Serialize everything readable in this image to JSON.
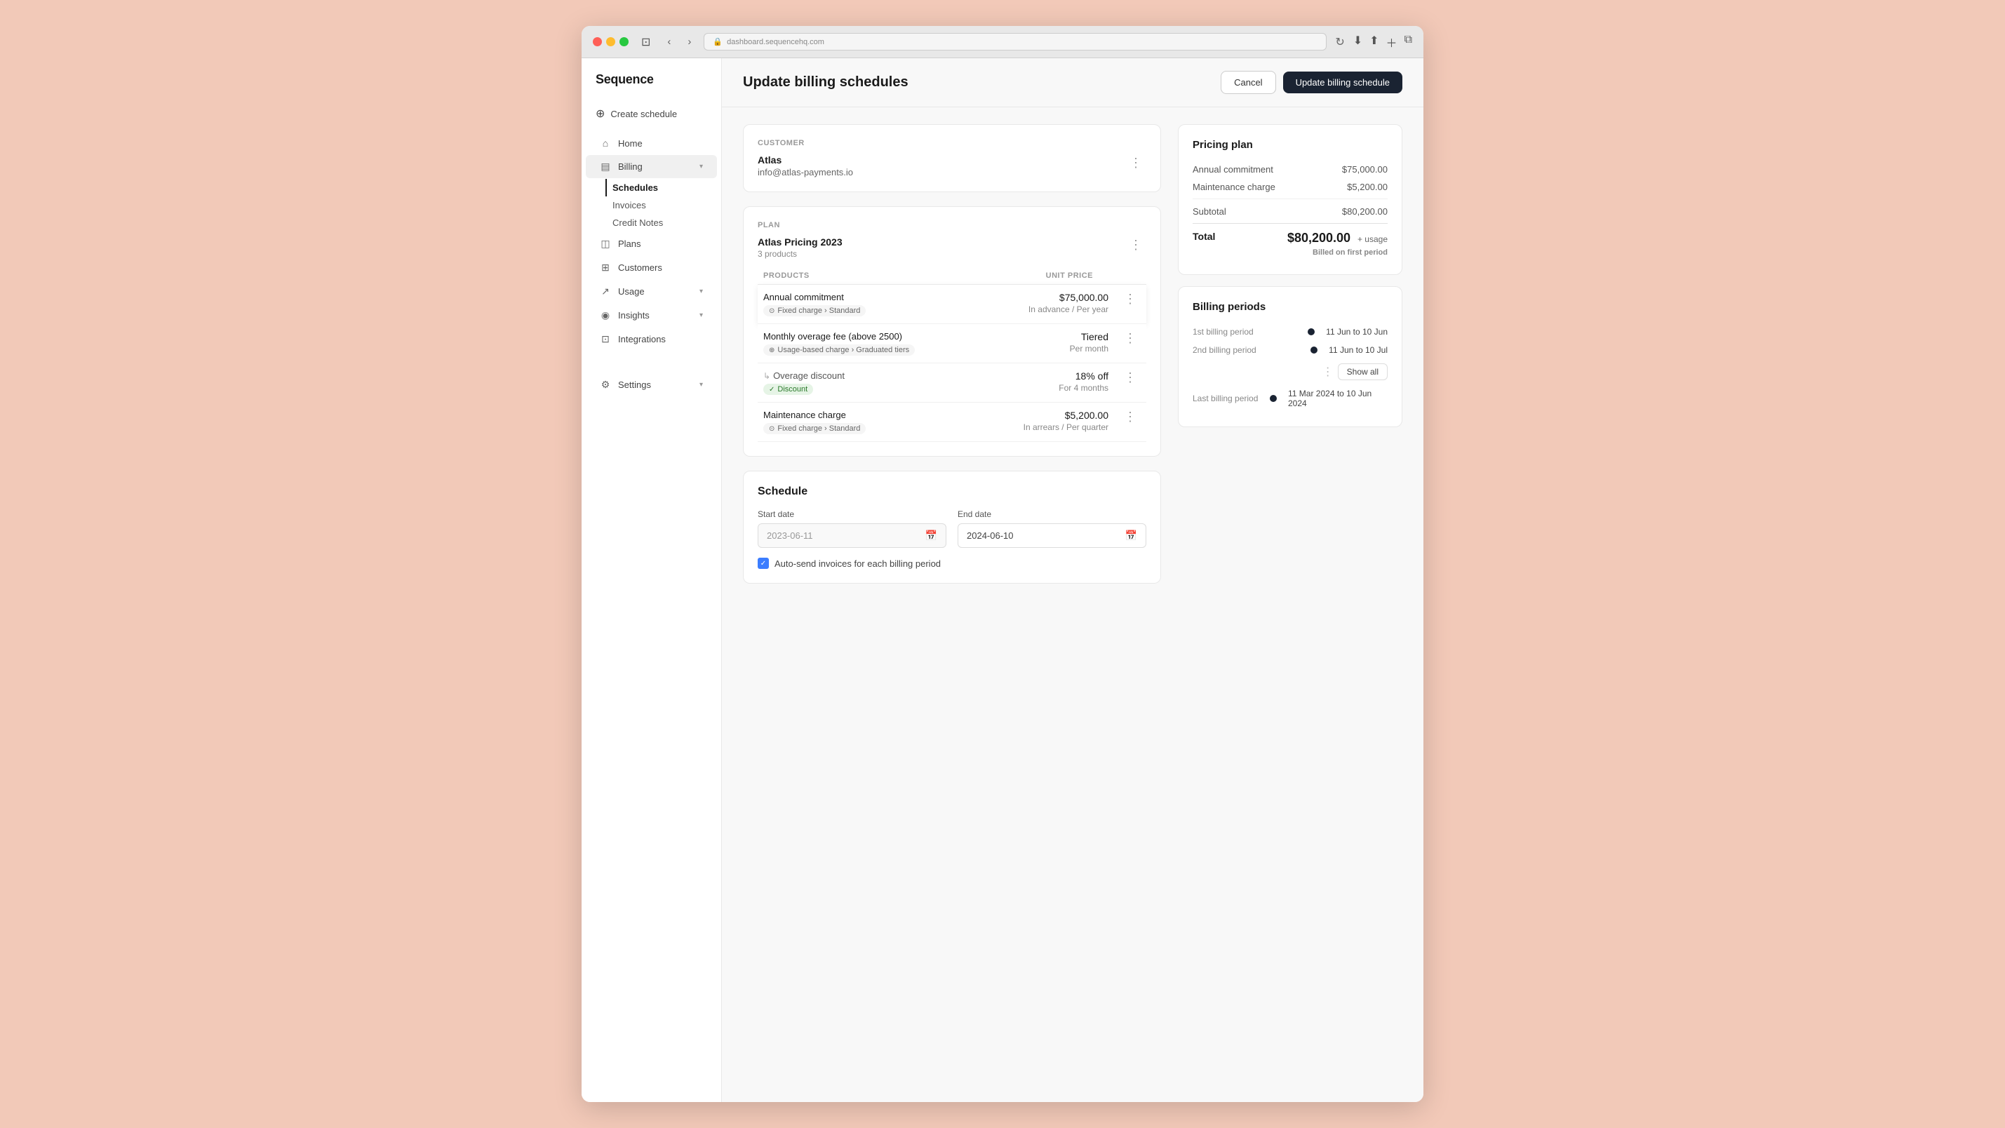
{
  "browser": {
    "url": "dashboard.sequencehq.com",
    "back": "‹",
    "forward": "›"
  },
  "sidebar": {
    "logo": "Sequence",
    "create_label": "Create schedule",
    "items": [
      {
        "id": "home",
        "label": "Home",
        "icon": "⌂"
      },
      {
        "id": "billing",
        "label": "Billing",
        "icon": "▤",
        "expanded": true,
        "children": [
          {
            "id": "schedules",
            "label": "Schedules",
            "active": true
          },
          {
            "id": "invoices",
            "label": "Invoices"
          },
          {
            "id": "credit-notes",
            "label": "Credit Notes"
          }
        ]
      },
      {
        "id": "plans",
        "label": "Plans",
        "icon": "◫"
      },
      {
        "id": "customers",
        "label": "Customers",
        "icon": "⊞"
      },
      {
        "id": "usage",
        "label": "Usage",
        "icon": "↗",
        "hasChevron": true
      },
      {
        "id": "insights",
        "label": "Insights",
        "icon": "◉",
        "hasChevron": true
      },
      {
        "id": "integrations",
        "label": "Integrations",
        "icon": "⊡"
      }
    ],
    "settings_label": "Settings"
  },
  "header": {
    "title": "Update billing schedules",
    "cancel_label": "Cancel",
    "update_label": "Update billing schedule"
  },
  "customer_section": {
    "label": "Customer",
    "name": "Atlas",
    "email": "info@atlas-payments.io"
  },
  "plan_section": {
    "label": "Plan",
    "name": "Atlas Pricing 2023",
    "products_count": "3 products",
    "table": {
      "col_products": "PRODUCTS",
      "col_unit_price": "UNIT PRICE",
      "rows": [
        {
          "id": "annual",
          "name": "Annual commitment",
          "badge": "Fixed charge › Standard",
          "badge_icon": "⊙",
          "price": "$75,000.00",
          "price_sub": "In advance / Per year",
          "shadow": true
        },
        {
          "id": "overage",
          "name": "Monthly overage fee (above 2500)",
          "badge": "Usage-based charge › Graduated tiers",
          "badge_icon": "⊕",
          "price": "Tiered",
          "price_sub": "Per month",
          "shadow": true
        },
        {
          "id": "discount",
          "name": "Overage discount",
          "sub": true,
          "badge": "Discount",
          "badge_icon": "✓",
          "badge_green": true,
          "price": "18% off",
          "price_sub": "For 4 months",
          "shadow": true
        },
        {
          "id": "maintenance",
          "name": "Maintenance charge",
          "badge": "Fixed charge › Standard",
          "badge_icon": "⊙",
          "price": "$5,200.00",
          "price_sub": "In arrears / Per quarter",
          "shadow": true
        }
      ]
    }
  },
  "schedule_section": {
    "title": "Schedule",
    "start_date_label": "Start date",
    "start_date_value": "2023-06-11",
    "end_date_label": "End date",
    "end_date_value": "2024-06-10",
    "auto_send_label": "Auto-send invoices for each billing period"
  },
  "pricing_plan": {
    "title": "Pricing plan",
    "rows": [
      {
        "label": "Annual commitment",
        "value": "$75,000.00"
      },
      {
        "label": "Maintenance charge",
        "value": "$5,200.00"
      }
    ],
    "subtotal_label": "Subtotal",
    "subtotal_value": "$80,200.00",
    "total_label": "Total",
    "total_amount": "$80,200.00",
    "total_usage": "+ usage",
    "billed_note": "Billed on first period"
  },
  "billing_periods": {
    "title": "Billing periods",
    "periods": [
      {
        "label": "1st billing period",
        "date": "11 Jun to 10 Jun"
      },
      {
        "label": "2nd billing period",
        "date": "11 Jun to 10 Jul"
      }
    ],
    "show_all_label": "Show all",
    "last_period_label": "Last billing period",
    "last_period_date": "11 Mar 2024 to 10 Jun 2024"
  }
}
